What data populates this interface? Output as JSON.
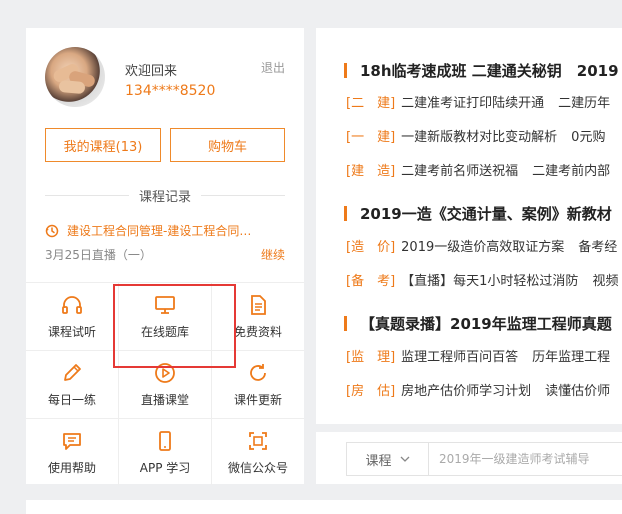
{
  "user": {
    "welcome": "欢迎回来",
    "phone": "134****8520",
    "logout": "退出"
  },
  "buttons": {
    "my_courses": "我的课程(13)",
    "cart": "购物车"
  },
  "record": {
    "title": "课程记录",
    "item": "建设工程合同管理-建设工程合同…",
    "date": "3月25日直播（一）",
    "continue": "继续"
  },
  "grid": [
    {
      "label": "课程试听",
      "icon": "headphones-icon"
    },
    {
      "label": "在线题库",
      "icon": "monitor-icon"
    },
    {
      "label": "免费资料",
      "icon": "document-icon"
    },
    {
      "label": "每日一练",
      "icon": "pencil-icon"
    },
    {
      "label": "直播课堂",
      "icon": "play-icon"
    },
    {
      "label": "课件更新",
      "icon": "refresh-icon"
    },
    {
      "label": "使用帮助",
      "icon": "chat-icon"
    },
    {
      "label": "APP 学习",
      "icon": "phone-icon"
    },
    {
      "label": "微信公众号",
      "icon": "scan-icon"
    }
  ],
  "news": {
    "sections": [
      {
        "title": "18h临考速成班 二建通关秘钥　2019",
        "rows": [
          {
            "tag": "[二　建]",
            "items": [
              "二建准考证打印陆续开通",
              "二建历年"
            ]
          },
          {
            "tag": "[一　建]",
            "items": [
              "一建新版教材对比变动解析",
              "0元购"
            ]
          },
          {
            "tag": "[建　造]",
            "items": [
              "二建考前名师送祝福",
              "二建考前内部"
            ]
          }
        ]
      },
      {
        "title": "2019一造《交通计量、案例》新教材",
        "rows": [
          {
            "tag": "[造　价]",
            "items": [
              "2019一级造价高效取证方案",
              "备考经"
            ]
          },
          {
            "tag": "[备　考]",
            "items": [
              "【直播】每天1小时轻松过消防",
              "视频"
            ]
          }
        ]
      },
      {
        "title": "【真题录播】2019年监理工程师真题",
        "rows": [
          {
            "tag": "[监　理]",
            "items": [
              "监理工程师百问百答",
              "历年监理工程"
            ]
          },
          {
            "tag": "[房　估]",
            "items": [
              "房地产估价师学习计划",
              "读懂估价师"
            ]
          }
        ]
      }
    ]
  },
  "search": {
    "select": "课程",
    "placeholder": "2019年一级建造师考试辅导"
  },
  "colors": {
    "accent": "#ee7a1a",
    "highlight": "#e53935"
  }
}
